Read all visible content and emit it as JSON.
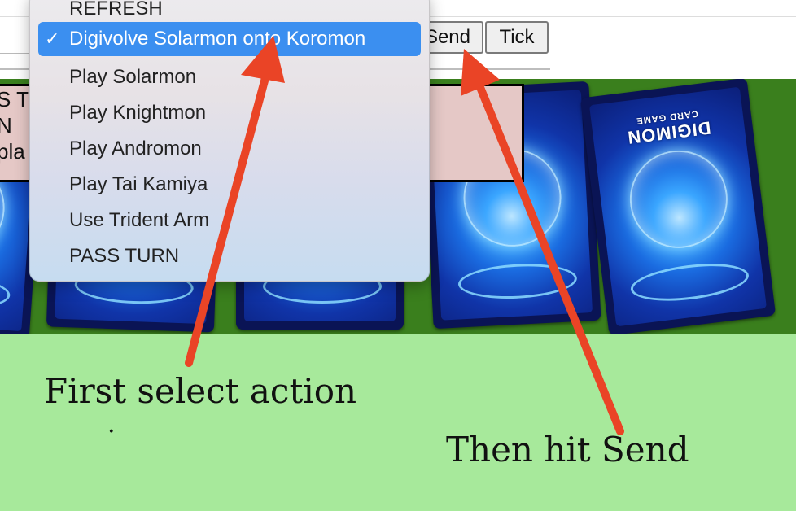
{
  "toolbar": {
    "send_label": "Send",
    "tick_label": "Tick"
  },
  "action_dropdown": {
    "partial_top": "REFRESH",
    "selected_option": "Digivolve Solarmon onto Koromon",
    "options": [
      "Play Solarmon",
      "Play Knightmon",
      "Play Andromon",
      "Play Tai Kamiya",
      "Use Trident Arm",
      "PASS TURN"
    ]
  },
  "log_panel": {
    "lines": [
      "S T",
      "N",
      "pla"
    ]
  },
  "cards": {
    "back_logo": "DIGIMON",
    "back_sub": "CARD GAME"
  },
  "annotations": {
    "first": "First select action",
    "second": "Then hit Send",
    "dot": "."
  },
  "colors": {
    "arrow": "#ea4426",
    "board": "#3a7f1d",
    "lower_area": "#a7e99b",
    "selected_highlight": "#3b8ff0",
    "log_box": "#e5c8c6"
  },
  "icons": {
    "selected_marker": "checkmark-icon",
    "annotation_arrows": "arrow-icon"
  }
}
